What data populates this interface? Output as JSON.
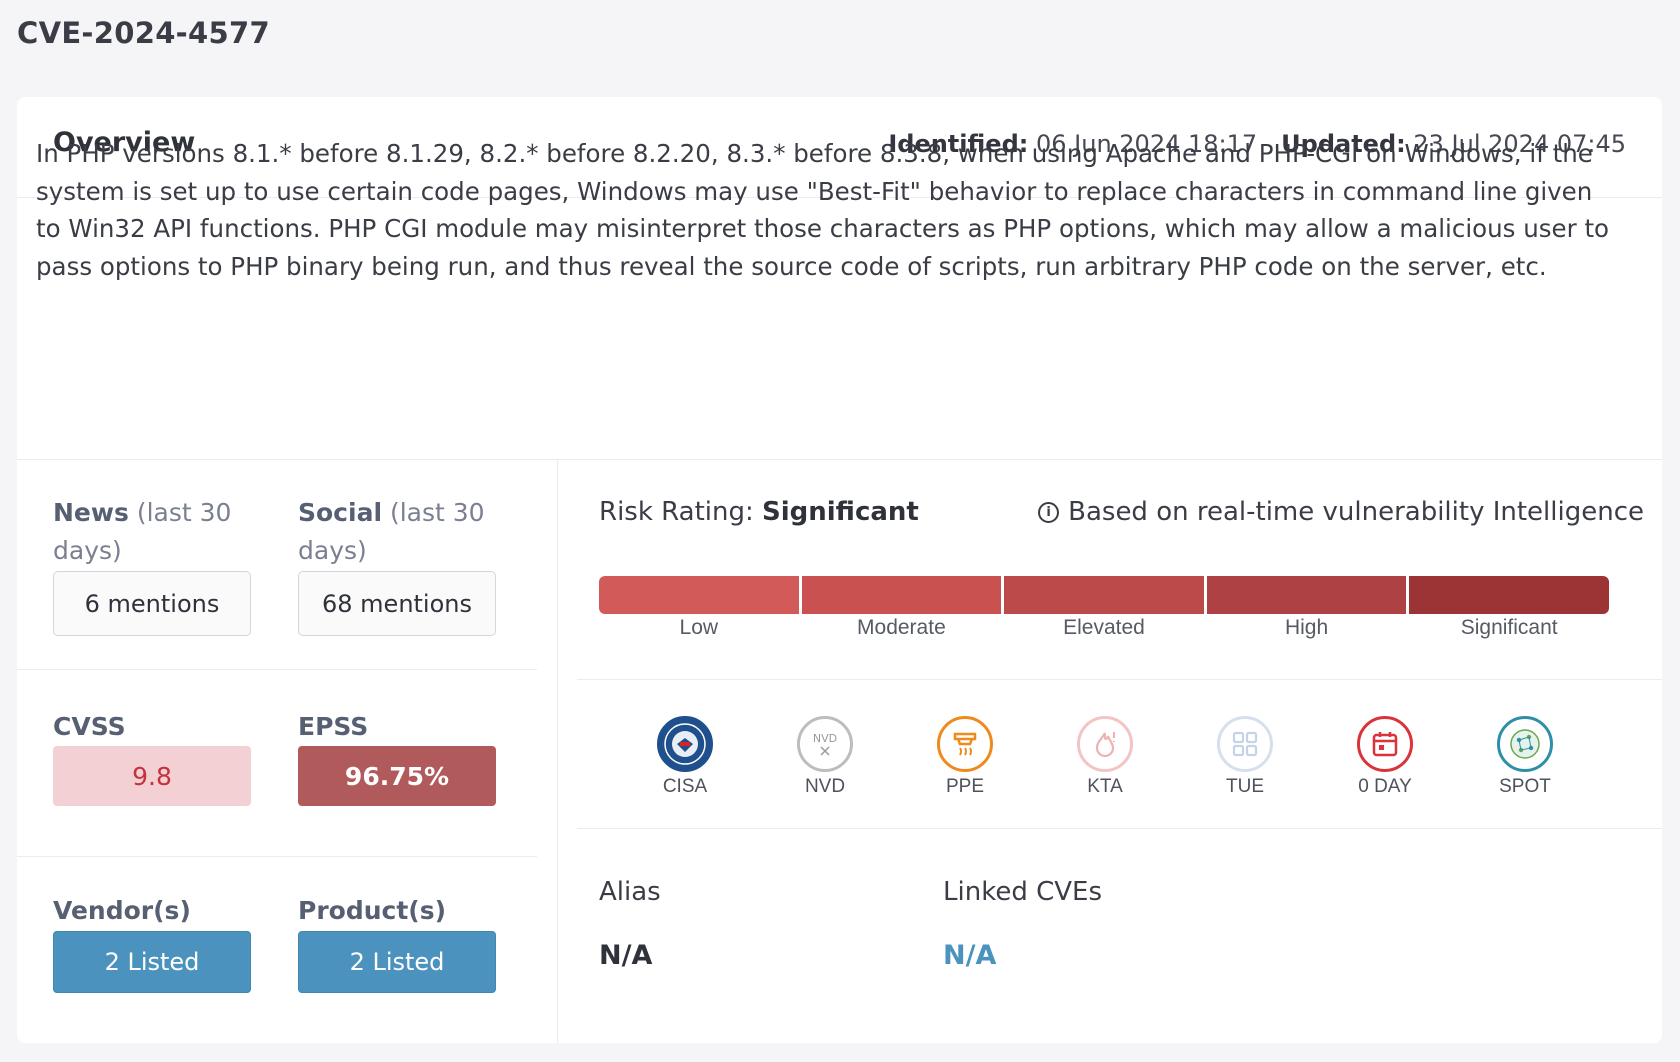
{
  "page": {
    "title": "CVE-2024-4577"
  },
  "overview": {
    "title": "Overview",
    "identified_label": "Identified:",
    "identified_value": "06 Jun 2024 18:17",
    "updated_label": "Updated:",
    "updated_value": "23 Jul 2024 07:45",
    "description": "In PHP versions 8.1.* before 8.1.29, 8.2.* before 8.2.20, 8.3.* before 8.3.8, when using Apache and PHP-CGI on Windows, if the system is set up to use certain code pages, Windows may use \"Best-Fit\" behavior to replace characters in command line given to Win32 API functions. PHP CGI module may misinterpret those characters as PHP options, which may allow a malicious user to pass options to PHP binary being run, and thus reveal the source code of scripts, run arbitrary PHP code on the server, etc."
  },
  "news": {
    "label": "News",
    "period": "(last 30 days)",
    "value": "6 mentions"
  },
  "social": {
    "label": "Social",
    "period": "(last 30 days)",
    "value": "68 mentions"
  },
  "cvss": {
    "label": "CVSS",
    "value": "9.8"
  },
  "epss": {
    "label": "EPSS",
    "value": "96.75%"
  },
  "vendors": {
    "label": "Vendor(s)",
    "value": "2 Listed"
  },
  "products": {
    "label": "Product(s)",
    "value": "2 Listed"
  },
  "risk": {
    "label": "Risk Rating:",
    "value": "Significant",
    "intel_text": "Based on real-time vulnerability Intelligence",
    "levels": [
      "Low",
      "Moderate",
      "Elevated",
      "High",
      "Significant"
    ],
    "level_colors": [
      "#d25a58",
      "#c9514f",
      "#bd4a4a",
      "#ae4143",
      "#9c3436"
    ]
  },
  "sources": [
    {
      "name": "CISA",
      "icon": "cisa-seal-icon",
      "color": "#1f4f8c",
      "active": true
    },
    {
      "name": "NVD",
      "icon": "nvd-icon",
      "color": "#9a9a9a",
      "active": false
    },
    {
      "name": "PPE",
      "icon": "ppe-icon",
      "color": "#ef8a1e",
      "active": true
    },
    {
      "name": "KTA",
      "icon": "kta-icon",
      "color": "#efb2b2",
      "active": false
    },
    {
      "name": "TUE",
      "icon": "tue-grid-icon",
      "color": "#c4d4e6",
      "active": false
    },
    {
      "name": "0 DAY",
      "icon": "calendar-icon",
      "color": "#d8343a",
      "active": true
    },
    {
      "name": "SPOT",
      "icon": "spot-icon",
      "color": "#2f8fa8",
      "active": true
    }
  ],
  "alias": {
    "label": "Alias",
    "value": "N/A"
  },
  "linked_cves": {
    "label": "Linked CVEs",
    "value": "N/A"
  }
}
